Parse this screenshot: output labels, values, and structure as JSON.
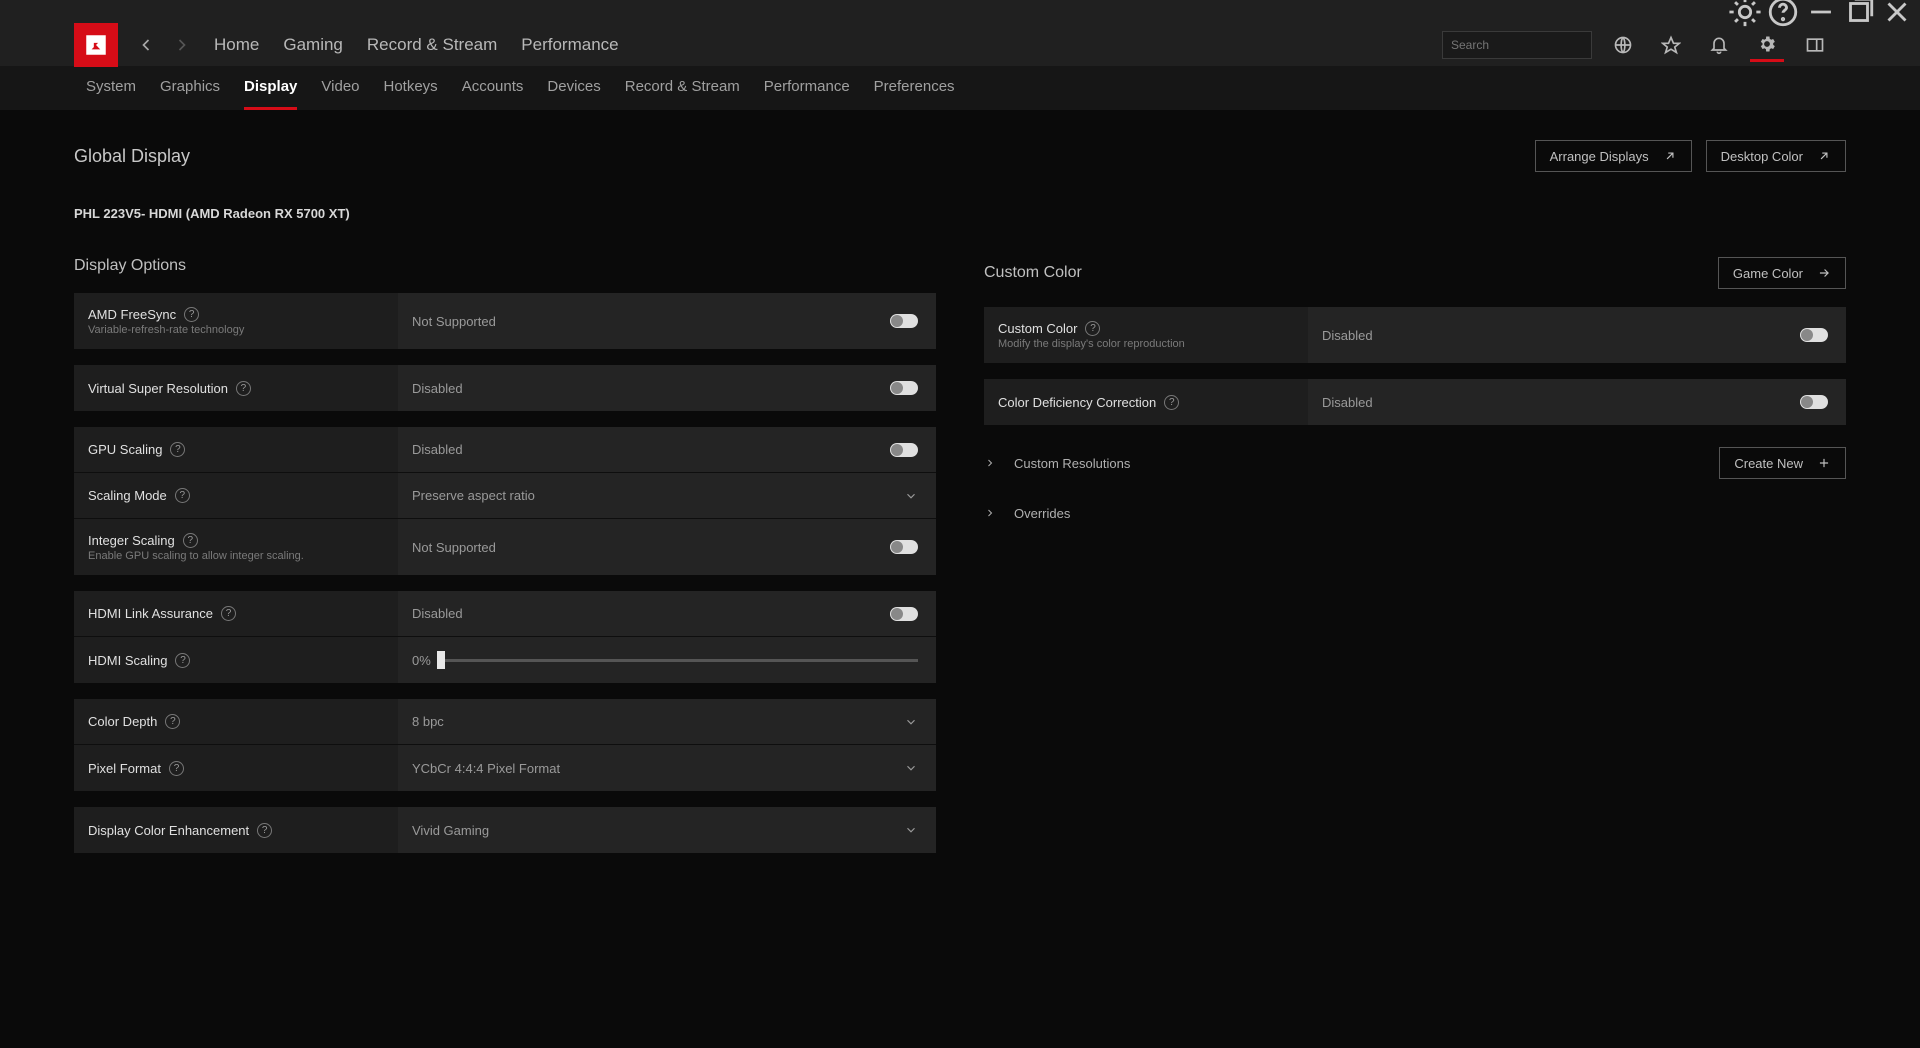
{
  "search": {
    "placeholder": "Search"
  },
  "main_tabs": [
    "Home",
    "Gaming",
    "Record & Stream",
    "Performance"
  ],
  "sub_tabs": [
    "System",
    "Graphics",
    "Display",
    "Video",
    "Hotkeys",
    "Accounts",
    "Devices",
    "Record & Stream",
    "Performance",
    "Preferences"
  ],
  "active_sub_tab": "Display",
  "page_title": "Global Display",
  "top_buttons": {
    "arrange": "Arrange Displays",
    "desktop_color": "Desktop Color"
  },
  "device": "PHL 223V5- HDMI (AMD Radeon RX 5700 XT)",
  "left": {
    "title": "Display Options",
    "rows": {
      "freesync": {
        "label": "AMD FreeSync",
        "sub": "Variable-refresh-rate technology",
        "value": "Not Supported"
      },
      "vsr": {
        "label": "Virtual Super Resolution",
        "value": "Disabled"
      },
      "gpu_scaling": {
        "label": "GPU Scaling",
        "value": "Disabled"
      },
      "scaling_mode": {
        "label": "Scaling Mode",
        "value": "Preserve aspect ratio"
      },
      "integer_scaling": {
        "label": "Integer Scaling",
        "sub": "Enable GPU scaling to allow integer scaling.",
        "value": "Not Supported"
      },
      "hdmi_link": {
        "label": "HDMI Link Assurance",
        "value": "Disabled"
      },
      "hdmi_scaling": {
        "label": "HDMI Scaling",
        "value": "0%"
      },
      "color_depth": {
        "label": "Color Depth",
        "value": "8 bpc"
      },
      "pixel_format": {
        "label": "Pixel Format",
        "value": "YCbCr 4:4:4 Pixel Format"
      },
      "color_enh": {
        "label": "Display Color Enhancement",
        "value": "Vivid Gaming"
      }
    }
  },
  "right": {
    "title": "Custom Color",
    "game_color_btn": "Game Color",
    "rows": {
      "custom_color": {
        "label": "Custom Color",
        "sub": "Modify the display's color reproduction",
        "value": "Disabled"
      },
      "color_def": {
        "label": "Color Deficiency Correction",
        "value": "Disabled"
      }
    },
    "exp_custom_res": "Custom Resolutions",
    "create_new_btn": "Create New",
    "exp_overrides": "Overrides"
  }
}
